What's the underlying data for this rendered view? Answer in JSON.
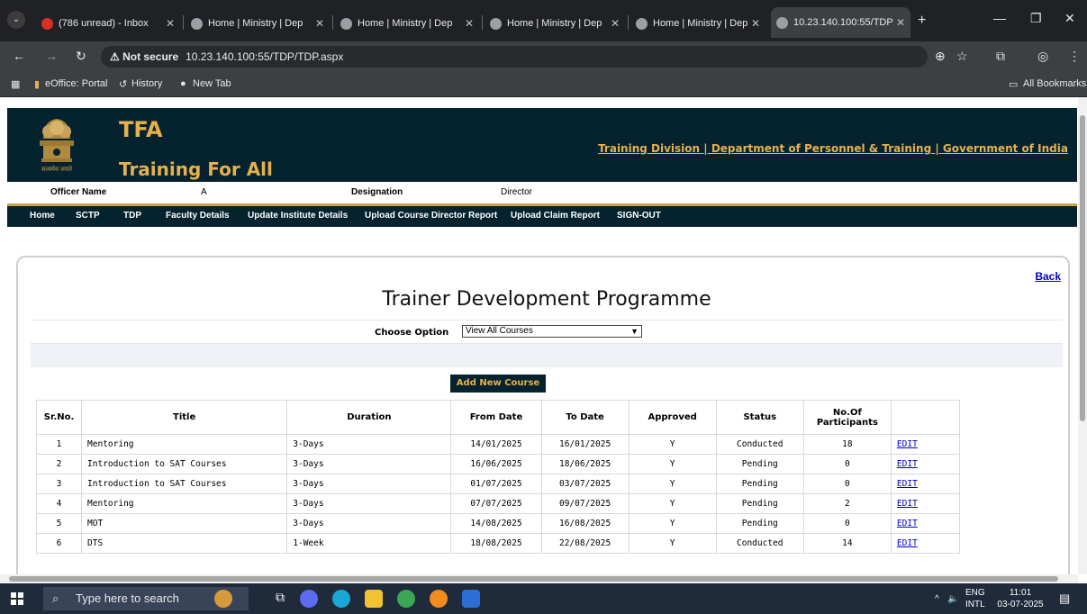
{
  "browser": {
    "tabs": [
      {
        "label": "(786 unread) - Inbox",
        "icon": "mail-icon"
      },
      {
        "label": "Home | Ministry | Dep",
        "icon": "globe-icon"
      },
      {
        "label": "Home | Ministry | Dep",
        "icon": "globe-icon"
      },
      {
        "label": "Home | Ministry | Dep",
        "icon": "globe-icon"
      },
      {
        "label": "Home | Ministry | Dep",
        "icon": "globe-icon"
      },
      {
        "label": "10.23.140.100:55/TDP",
        "icon": "globe-icon"
      }
    ],
    "security_label": "Not secure",
    "url": "10.23.140.100:55/TDP/TDP.aspx",
    "bookmarks": [
      "eOffice: Portal",
      "History",
      "New Tab"
    ],
    "all_bookmarks": "All Bookmarks"
  },
  "header": {
    "brand": "TFA",
    "subtitle": "Training For All",
    "emblem_text": "सत्यमेव जयते",
    "org_link": "Training Division | Department of Personnel & Training | Government of India"
  },
  "officer": {
    "name_label": "Officer Name",
    "name_value": "A",
    "designation_label": "Designation",
    "designation_value": "Director"
  },
  "menu": [
    "Home",
    "SCTP",
    "TDP",
    "Faculty Details",
    "Update Institute Details",
    "Upload Course Director Report",
    "Upload Claim Report",
    "SIGN-OUT"
  ],
  "main": {
    "back": "Back",
    "title": "Trainer Development Programme",
    "choose_label": "Choose Option",
    "choose_value": "View All Courses",
    "add_button": "Add New Course",
    "columns": [
      "Sr.No.",
      "Title",
      "Duration",
      "From Date",
      "To Date",
      "Approved",
      "Status",
      "No.Of Participants",
      ""
    ],
    "rows": [
      {
        "sr": "1",
        "title": "Mentoring",
        "duration": "3-Days",
        "from": "14/01/2025",
        "to": "16/01/2025",
        "approved": "Y",
        "status": "Conducted",
        "participants": "18",
        "action": "EDIT"
      },
      {
        "sr": "2",
        "title": "Introduction to SAT Courses",
        "duration": "3-Days",
        "from": "16/06/2025",
        "to": "18/06/2025",
        "approved": "Y",
        "status": "Pending",
        "participants": "0",
        "action": "EDIT"
      },
      {
        "sr": "3",
        "title": "Introduction to SAT Courses",
        "duration": "3-Days",
        "from": "01/07/2025",
        "to": "03/07/2025",
        "approved": "Y",
        "status": "Pending",
        "participants": "0",
        "action": "EDIT"
      },
      {
        "sr": "4",
        "title": "Mentoring",
        "duration": "3-Days",
        "from": "07/07/2025",
        "to": "09/07/2025",
        "approved": "Y",
        "status": "Pending",
        "participants": "2",
        "action": "EDIT"
      },
      {
        "sr": "5",
        "title": "MOT",
        "duration": "3-Days",
        "from": "14/08/2025",
        "to": "16/08/2025",
        "approved": "Y",
        "status": "Pending",
        "participants": "0",
        "action": "EDIT"
      },
      {
        "sr": "6",
        "title": "DTS",
        "duration": "1-Week",
        "from": "18/08/2025",
        "to": "22/08/2025",
        "approved": "Y",
        "status": "Conducted",
        "participants": "14",
        "action": "EDIT"
      }
    ]
  },
  "taskbar": {
    "search_placeholder": "Type here to search",
    "lang_top": "ENG",
    "lang_bottom": "INTL",
    "time": "11:01",
    "date": "03-07-2025"
  }
}
